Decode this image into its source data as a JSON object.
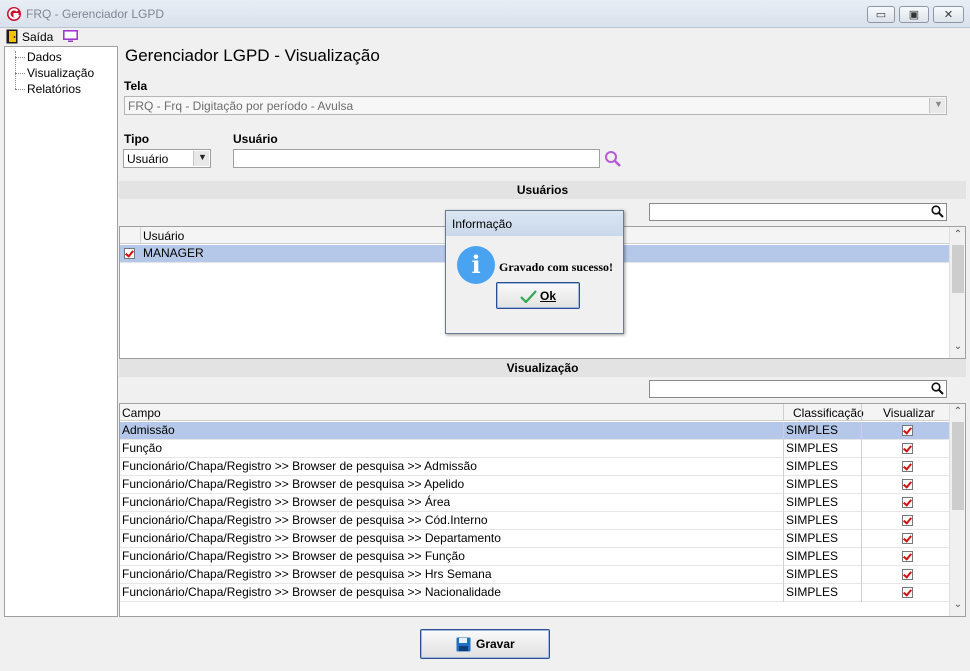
{
  "window": {
    "title": "FRQ - Gerenciador LGPD",
    "min_glyph": "▭",
    "max_glyph": "▣",
    "close_glyph": "✕"
  },
  "menu": {
    "exit_label": "Saída"
  },
  "tree": {
    "items": [
      "Dados",
      "Visualização",
      "Relatórios"
    ]
  },
  "main": {
    "page_title": "Gerenciador LGPD - Visualização",
    "tela_label": "Tela",
    "tela_value": "FRQ - Frq - Digitação por período - Avulsa",
    "tipo_label": "Tipo",
    "tipo_value": "Usuário",
    "usuario_label": "Usuário",
    "usuario_value": ""
  },
  "users_section": {
    "title": "Usuários",
    "search_value": "",
    "column": "Usuário",
    "rows": [
      {
        "name": "MANAGER",
        "checked": true
      }
    ]
  },
  "visual_section": {
    "title": "Visualização",
    "search_value": "",
    "columns": [
      "Campo",
      "Classificação",
      "Visualizar"
    ],
    "rows": [
      {
        "campo": "Admissão",
        "classificacao": "SIMPLES"
      },
      {
        "campo": "Função",
        "classificacao": "SIMPLES"
      },
      {
        "campo": "Funcionário/Chapa/Registro >> Browser de pesquisa >> Admissão",
        "classificacao": "SIMPLES"
      },
      {
        "campo": "Funcionário/Chapa/Registro >> Browser de pesquisa >> Apelido",
        "classificacao": "SIMPLES"
      },
      {
        "campo": "Funcionário/Chapa/Registro >> Browser de pesquisa >> Área",
        "classificacao": "SIMPLES"
      },
      {
        "campo": "Funcionário/Chapa/Registro >> Browser de pesquisa >> Cód.Interno",
        "classificacao": "SIMPLES"
      },
      {
        "campo": "Funcionário/Chapa/Registro >> Browser de pesquisa >> Departamento",
        "classificacao": "SIMPLES"
      },
      {
        "campo": "Funcionário/Chapa/Registro >> Browser de pesquisa >> Função",
        "classificacao": "SIMPLES"
      },
      {
        "campo": "Funcionário/Chapa/Registro >> Browser de pesquisa >> Hrs Semana",
        "classificacao": "SIMPLES"
      },
      {
        "campo": "Funcionário/Chapa/Registro >> Browser de pesquisa >> Nacionalidade",
        "classificacao": "SIMPLES"
      }
    ]
  },
  "dialog": {
    "title": "Informação",
    "message": "Gravado com sucesso!",
    "ok_label": "Ok"
  },
  "footer": {
    "save_label": "Gravar"
  },
  "colors": {
    "selection": "#b5c8e9",
    "check_red": "#d31010",
    "info_blue": "#4aa3f0",
    "brand_red": "#c8102e"
  }
}
